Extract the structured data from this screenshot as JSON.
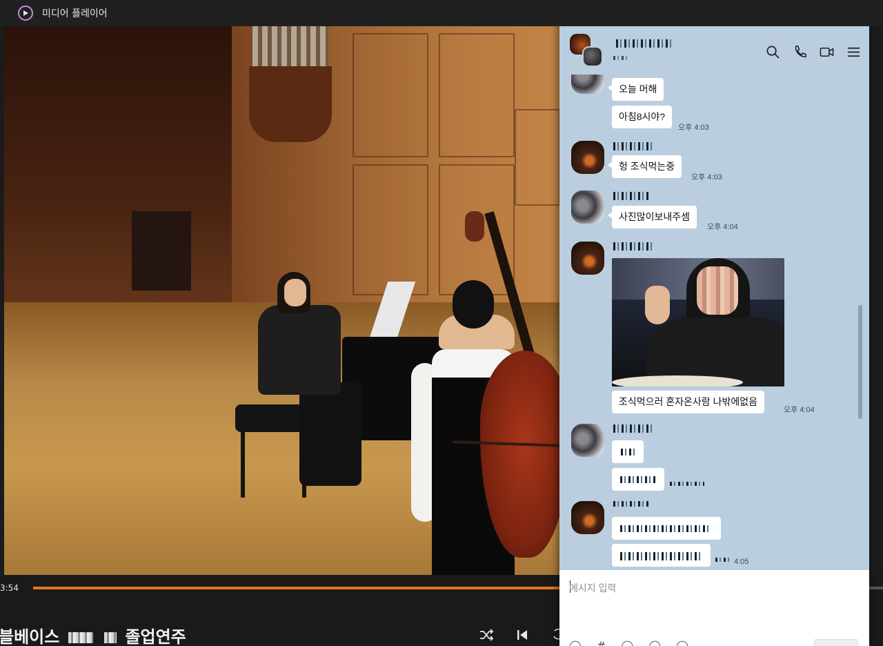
{
  "player": {
    "app_title": "미디어 플레이어",
    "time_current": "3:54",
    "progress_fraction": 0.62,
    "accent_color": "#e8741d",
    "video_title_pre": "블베이스",
    "video_title_post": "졸업연주",
    "controls": [
      "shuffle-icon",
      "previous-icon",
      "rewind-icon"
    ]
  },
  "chat": {
    "window_controls": [
      "minimize-icon",
      "maximize-icon",
      "close-icon"
    ],
    "header_icons": [
      "search-icon",
      "phone-icon",
      "video-call-icon",
      "menu-icon"
    ],
    "messages": [
      {
        "text": "오늘 머해"
      },
      {
        "text": "아침8시야?",
        "time": "오후 4:03"
      },
      {
        "text": "헝 조식먹는중",
        "time": "오후 4:03"
      },
      {
        "text": "사진많이보내주셈",
        "time": "오후 4:04"
      },
      {
        "text": "조식먹으러 혼자온사람 나밖에없음",
        "time": "오후 4:04"
      },
      {
        "time": "4:05"
      }
    ],
    "input_placeholder": "메시지 입력",
    "background_color": "#bacee0"
  }
}
